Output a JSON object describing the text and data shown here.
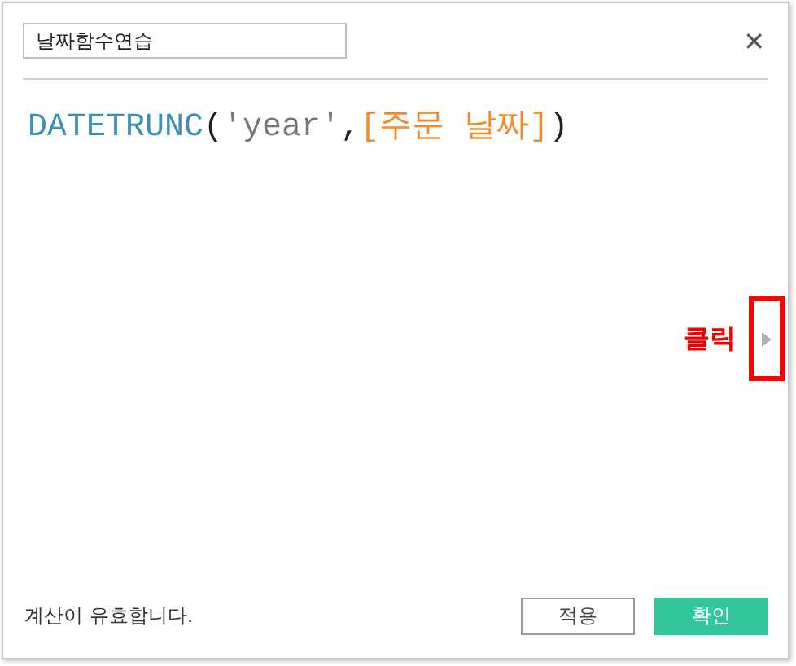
{
  "dialog": {
    "name_field": {
      "value": "날짜함수연습"
    },
    "close": "✕"
  },
  "formula": [
    {
      "kind": "function",
      "text": "DATETRUNC"
    },
    {
      "kind": "punct",
      "text": "("
    },
    {
      "kind": "string",
      "text": "'year'"
    },
    {
      "kind": "punct",
      "text": ","
    },
    {
      "kind": "field",
      "text": "[주문 날짜]"
    },
    {
      "kind": "punct",
      "text": ")"
    }
  ],
  "annotation": {
    "label": "클릭"
  },
  "status": "계산이 유효합니다.",
  "buttons": [
    {
      "label": "적용",
      "kind": "secondary"
    },
    {
      "label": "확인",
      "kind": "primary"
    }
  ]
}
